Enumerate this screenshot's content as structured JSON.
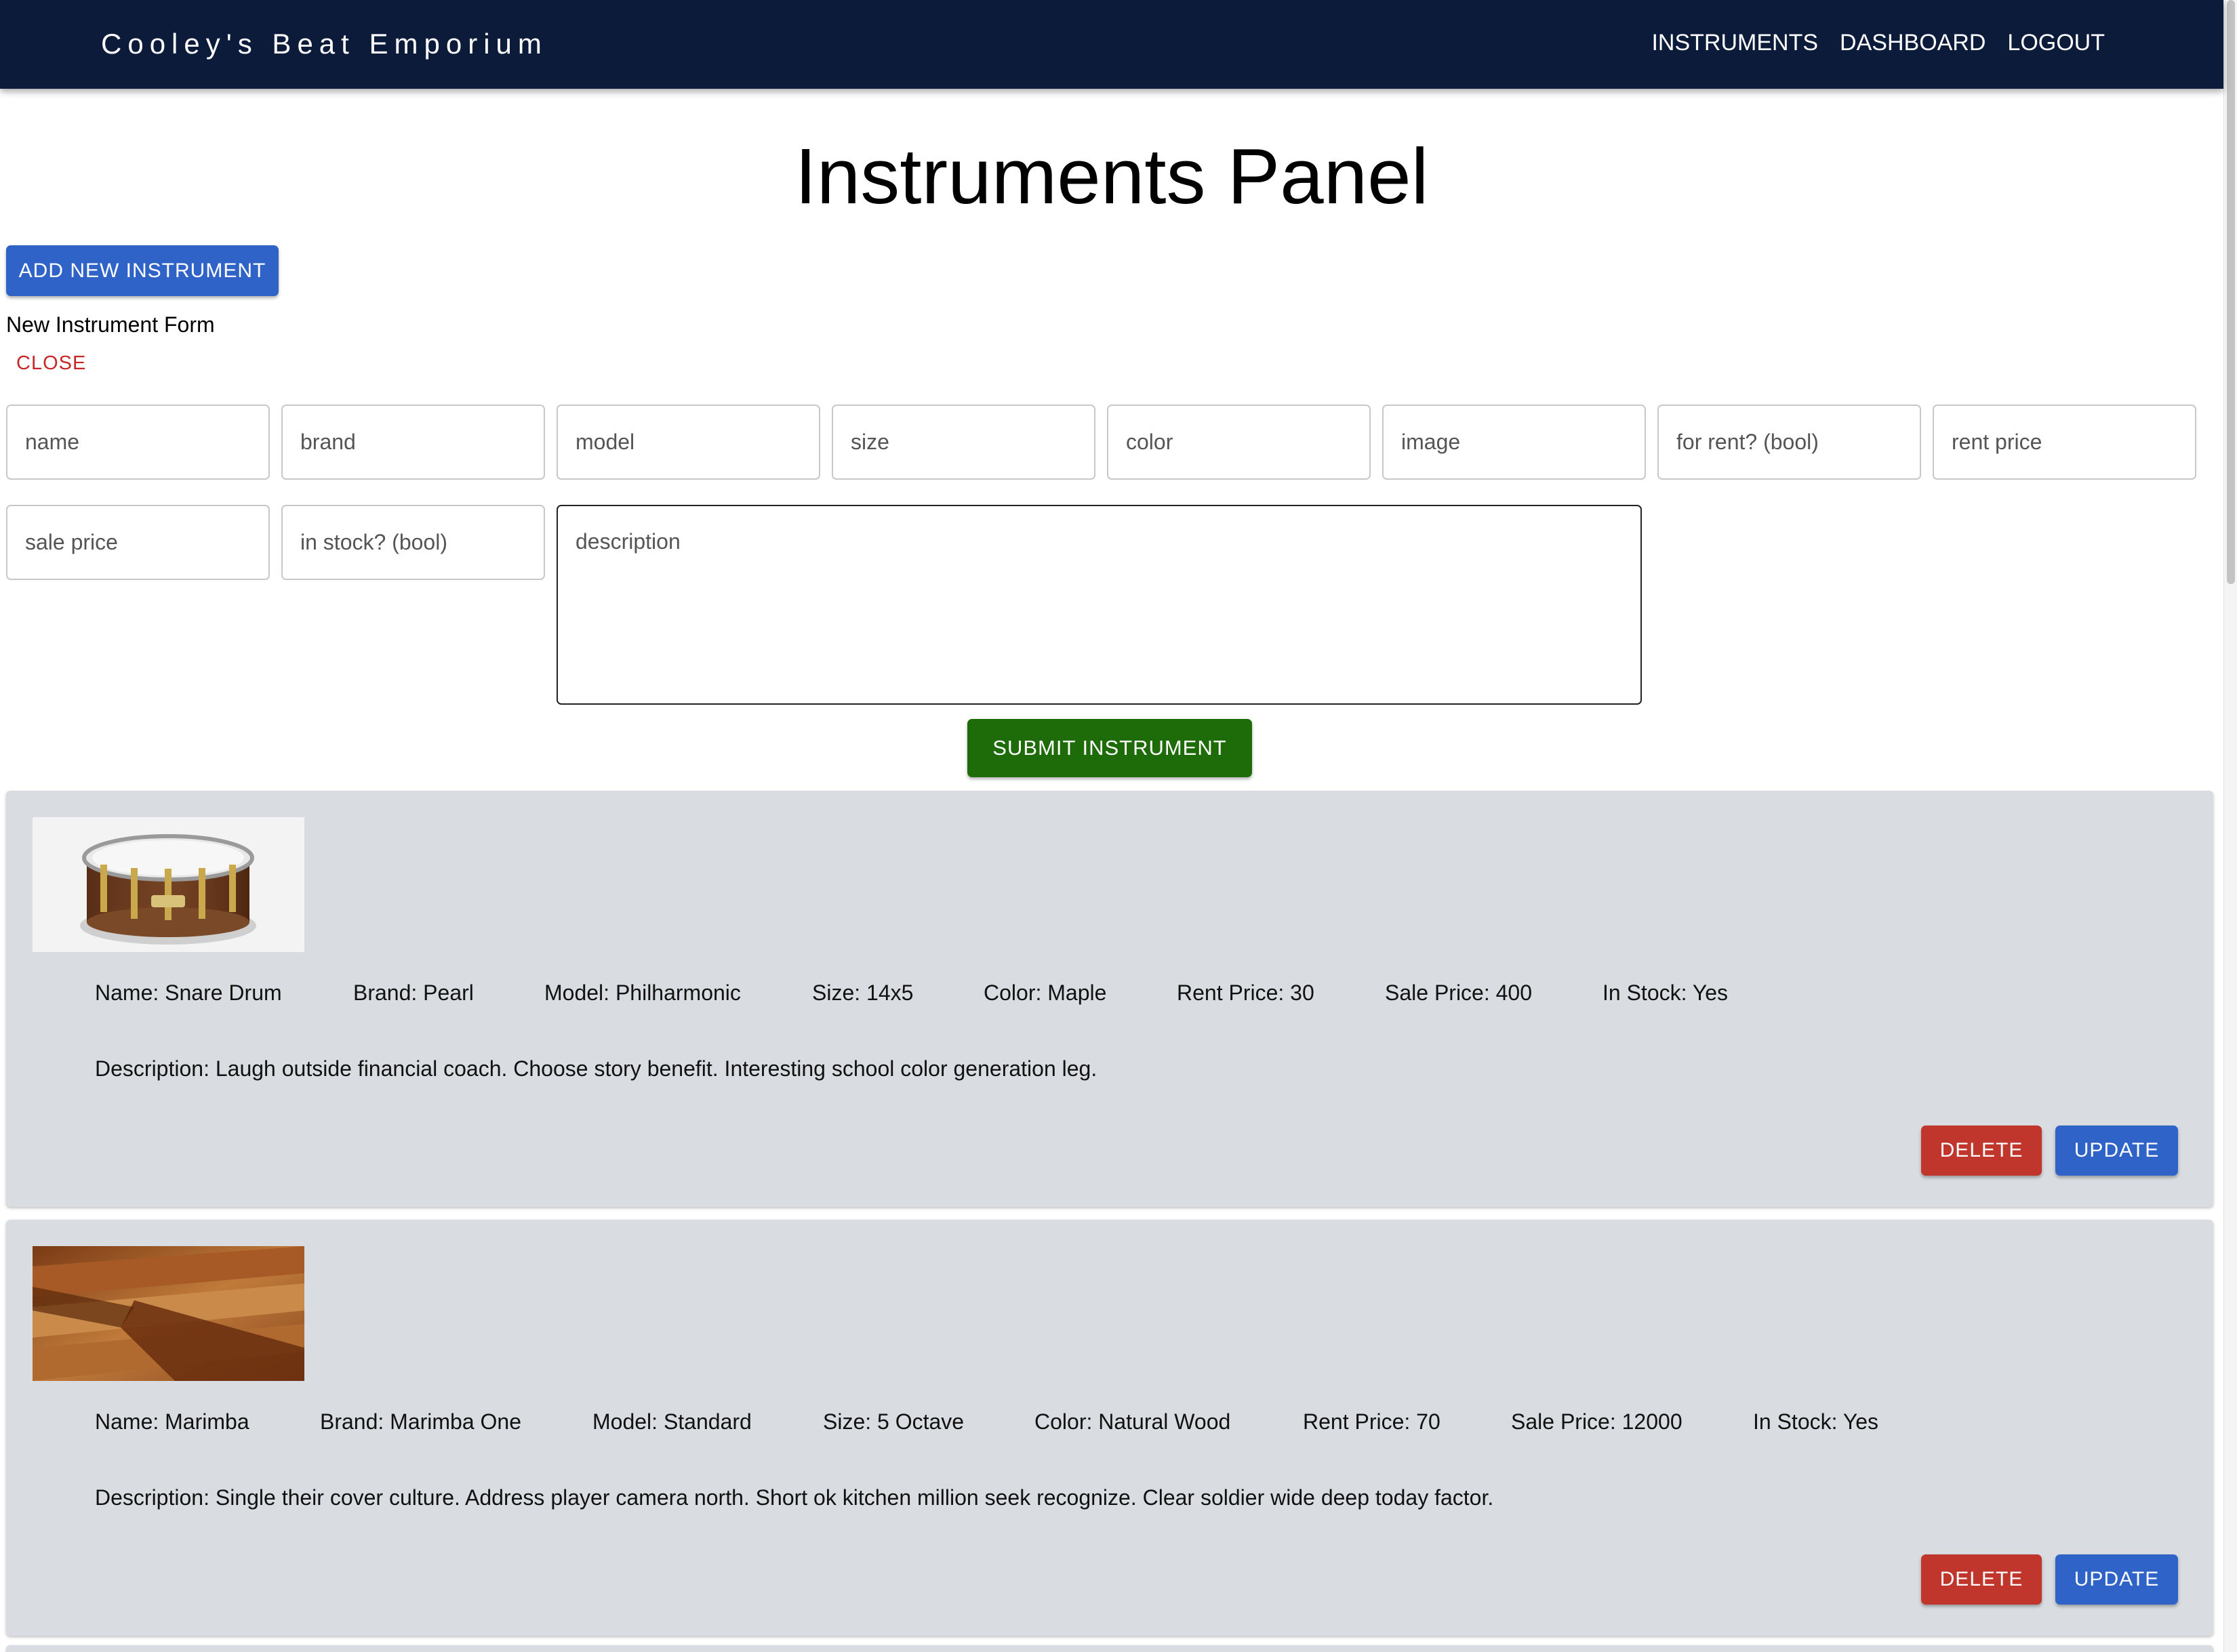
{
  "app": {
    "brand": "Cooley's Beat Emporium",
    "nav": [
      "INSTRUMENTS",
      "DASHBOARD",
      "LOGOUT"
    ]
  },
  "page_title": "Instruments Panel",
  "add_button": "ADD NEW INSTRUMENT",
  "form": {
    "heading": "New Instrument Form",
    "close_label": "CLOSE",
    "placeholders": {
      "name": "name",
      "brand": "brand",
      "model": "model",
      "size": "size",
      "color": "color",
      "image": "image",
      "for_rent": "for rent? (bool)",
      "rent_price": "rent price",
      "sale_price": "sale price",
      "in_stock": "in stock? (bool)",
      "description": "description"
    },
    "submit_label": "SUBMIT INSTRUMENT"
  },
  "instruments": [
    {
      "image_icon": "snare-drum-image",
      "name": "Name: Snare Drum",
      "brand": "Brand: Pearl",
      "model": "Model: Philharmonic",
      "size": "Size: 14x5",
      "color": "Color: Maple",
      "rent_price": "Rent Price: 30",
      "sale_price": "Sale Price: 400",
      "in_stock": "In Stock: Yes",
      "description": "Description: Laugh outside financial coach. Choose story benefit. Interesting school color generation leg.",
      "delete_label": "DELETE",
      "update_label": "UPDATE"
    },
    {
      "image_icon": "marimba-image",
      "name": "Name: Marimba",
      "brand": "Brand: Marimba One",
      "model": "Model: Standard",
      "size": "Size: 5 Octave",
      "color": "Color: Natural Wood",
      "rent_price": "Rent Price: 70",
      "sale_price": "Sale Price: 12000",
      "in_stock": "In Stock: Yes",
      "description": "Description: Single their cover culture. Address player camera north. Short ok kitchen million seek recognize. Clear soldier wide deep today factor.",
      "delete_label": "DELETE",
      "update_label": "UPDATE"
    }
  ],
  "colors": {
    "appbar": "#0d1b3a",
    "primary": "#2f63c8",
    "danger": "#c0362c",
    "success": "#1e6b0a",
    "card_bg": "#d9dce0"
  }
}
